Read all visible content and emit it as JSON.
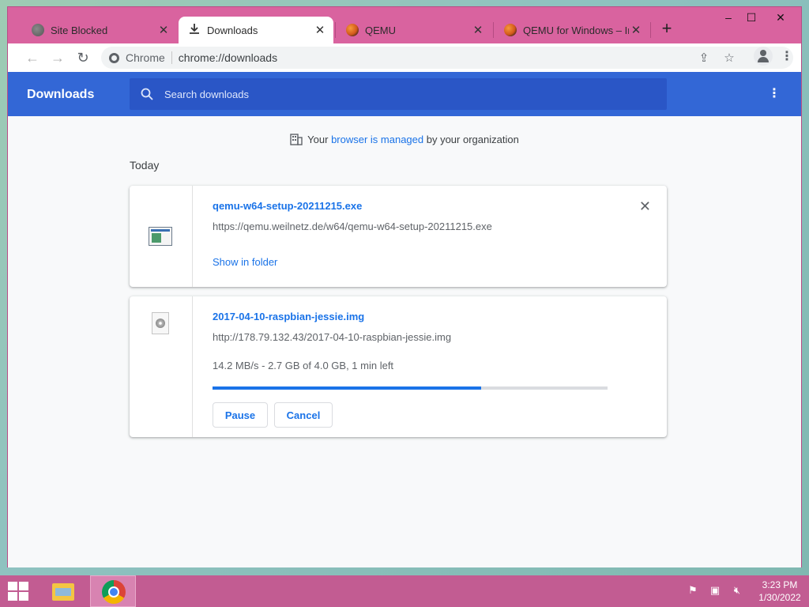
{
  "browser": {
    "tabs": [
      {
        "title": "Site Blocked",
        "favicon": "globe-icon",
        "active": false
      },
      {
        "title": "Downloads",
        "favicon": "download-icon",
        "active": true
      },
      {
        "title": "QEMU",
        "favicon": "qemu-icon",
        "active": false
      },
      {
        "title": "QEMU for Windows – Ins",
        "favicon": "qemu-icon",
        "active": false
      }
    ],
    "newtab_label": "+",
    "window_controls": {
      "minimize": "–",
      "maximize": "☐",
      "close": "✕"
    },
    "omnibox": {
      "chip": "Chrome",
      "url": "chrome://downloads"
    }
  },
  "downloads_page": {
    "title": "Downloads",
    "search_placeholder": "Search downloads",
    "managed_prefix": "Your ",
    "managed_link": "browser is managed",
    "managed_suffix": " by your organization",
    "section": "Today",
    "items": [
      {
        "filename": "qemu-w64-setup-20211215.exe",
        "url": "https://qemu.weilnetz.de/w64/qemu-w64-setup-20211215.exe",
        "link": "Show in folder",
        "icon": "exe-file-icon"
      },
      {
        "filename": "2017-04-10-raspbian-jessie.img",
        "url": "http://178.79.132.43/2017-04-10-raspbian-jessie.img",
        "status": "14.2 MB/s - 2.7 GB of 4.0 GB, 1 min left",
        "progress": 0.68,
        "pause_label": "Pause",
        "cancel_label": "Cancel",
        "icon": "disk-image-icon"
      }
    ]
  },
  "taskbar": {
    "time": "3:23 PM",
    "date": "1/30/2022"
  },
  "colors": {
    "header_blue": "#3367d6",
    "link_blue": "#1a73e8",
    "window_frame": "#d9639f",
    "taskbar": "#c25c92"
  }
}
